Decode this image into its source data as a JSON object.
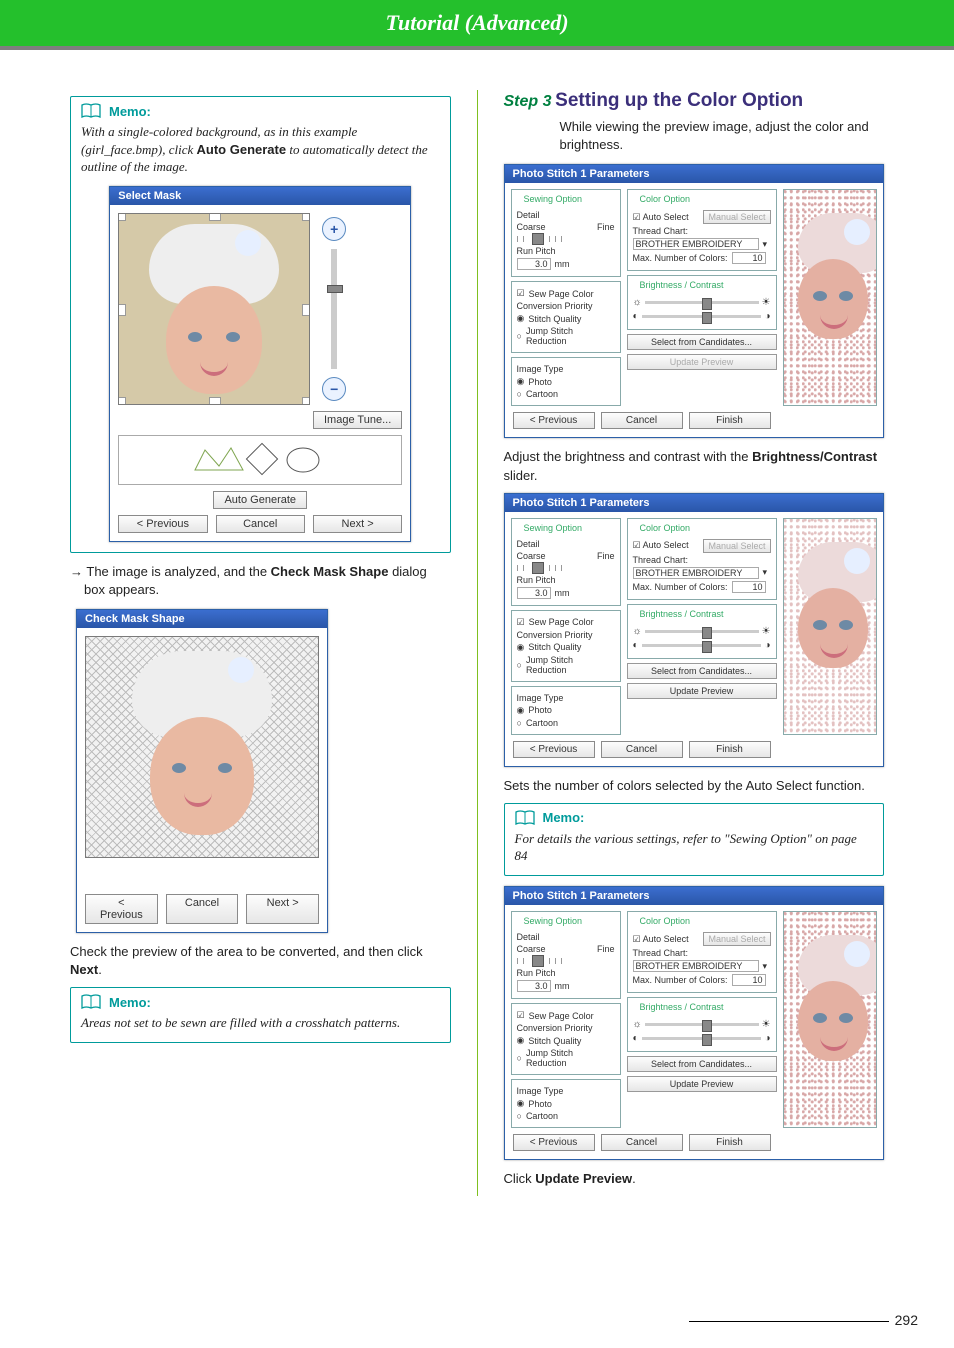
{
  "header": {
    "title": "Tutorial (Advanced)"
  },
  "page_number": "292",
  "left": {
    "memo1": {
      "label": "Memo:",
      "body_pre": "With a single-colored background, as in this example (girl_face.bmp), click ",
      "body_bold": "Auto Generate",
      "body_post": " to automatically detect the outline of the image."
    },
    "selectMask": {
      "title": "Select Mask",
      "imageTune": "Image Tune...",
      "autoGenerate": "Auto Generate",
      "prev": "< Previous",
      "cancel": "Cancel",
      "next": "Next >"
    },
    "arrowLine": {
      "arrow": "→ ",
      "pre": "The image is analyzed, and the ",
      "bold": "Check Mask Shape",
      "post": " dialog box appears."
    },
    "checkMask": {
      "title": "Check Mask Shape",
      "prev": "< Previous",
      "cancel": "Cancel",
      "next": "Next >"
    },
    "checkText": {
      "pre": "Check the preview of the area to be converted, and then click ",
      "bold": "Next",
      "post": "."
    },
    "memo2": {
      "label": "Memo:",
      "body": "Areas not set to be sewn are filled with a crosshatch patterns."
    }
  },
  "right": {
    "step": {
      "n": "Step 3",
      "title": "Setting up the Color Option"
    },
    "intro": "While viewing the preview image, adjust the color and brightness.",
    "ps": {
      "title": "Photo Stitch 1 Parameters",
      "sewingOption": "Sewing Option",
      "detail": "Detail",
      "coarse": "Coarse",
      "fine": "Fine",
      "runPitch": "Run Pitch",
      "runPitchValue": "3.0",
      "mm": "mm",
      "sewPageColor": "Sew Page Color",
      "convPriority": "Conversion Priority",
      "stitchQuality": "Stitch Quality",
      "jumpReduction": "Jump Stitch Reduction",
      "imageType": "Image Type",
      "photo": "Photo",
      "cartoon": "Cartoon",
      "colorOption": "Color Option",
      "autoSelect": "Auto Select",
      "manual": "Manual Select",
      "threadChart": "Thread Chart:",
      "threadChartValue": "BROTHER EMBROIDERY",
      "maxColors": "Max. Number of Colors:",
      "maxColorsValue": "10",
      "brightContrast": "Brightness / Contrast",
      "selectCandidates": "Select from Candidates...",
      "updatePreviewDim": "Update Preview",
      "updatePreview": "Update Preview",
      "prev": "< Previous",
      "cancel": "Cancel",
      "finish": "Finish"
    },
    "adjustText": {
      "pre": "Adjust the brightness and contrast with the ",
      "bold": "Brightness/Contrast",
      "post": " slider."
    },
    "autoSelectText": "Sets the number of colors selected by the Auto Select function.",
    "memo3": {
      "label": "Memo:",
      "body": "For details the various settings, refer to \"Sewing Option\" on page 84"
    },
    "clickUpdate": {
      "pre": "Click ",
      "bold": "Update Preview",
      "post": "."
    }
  }
}
